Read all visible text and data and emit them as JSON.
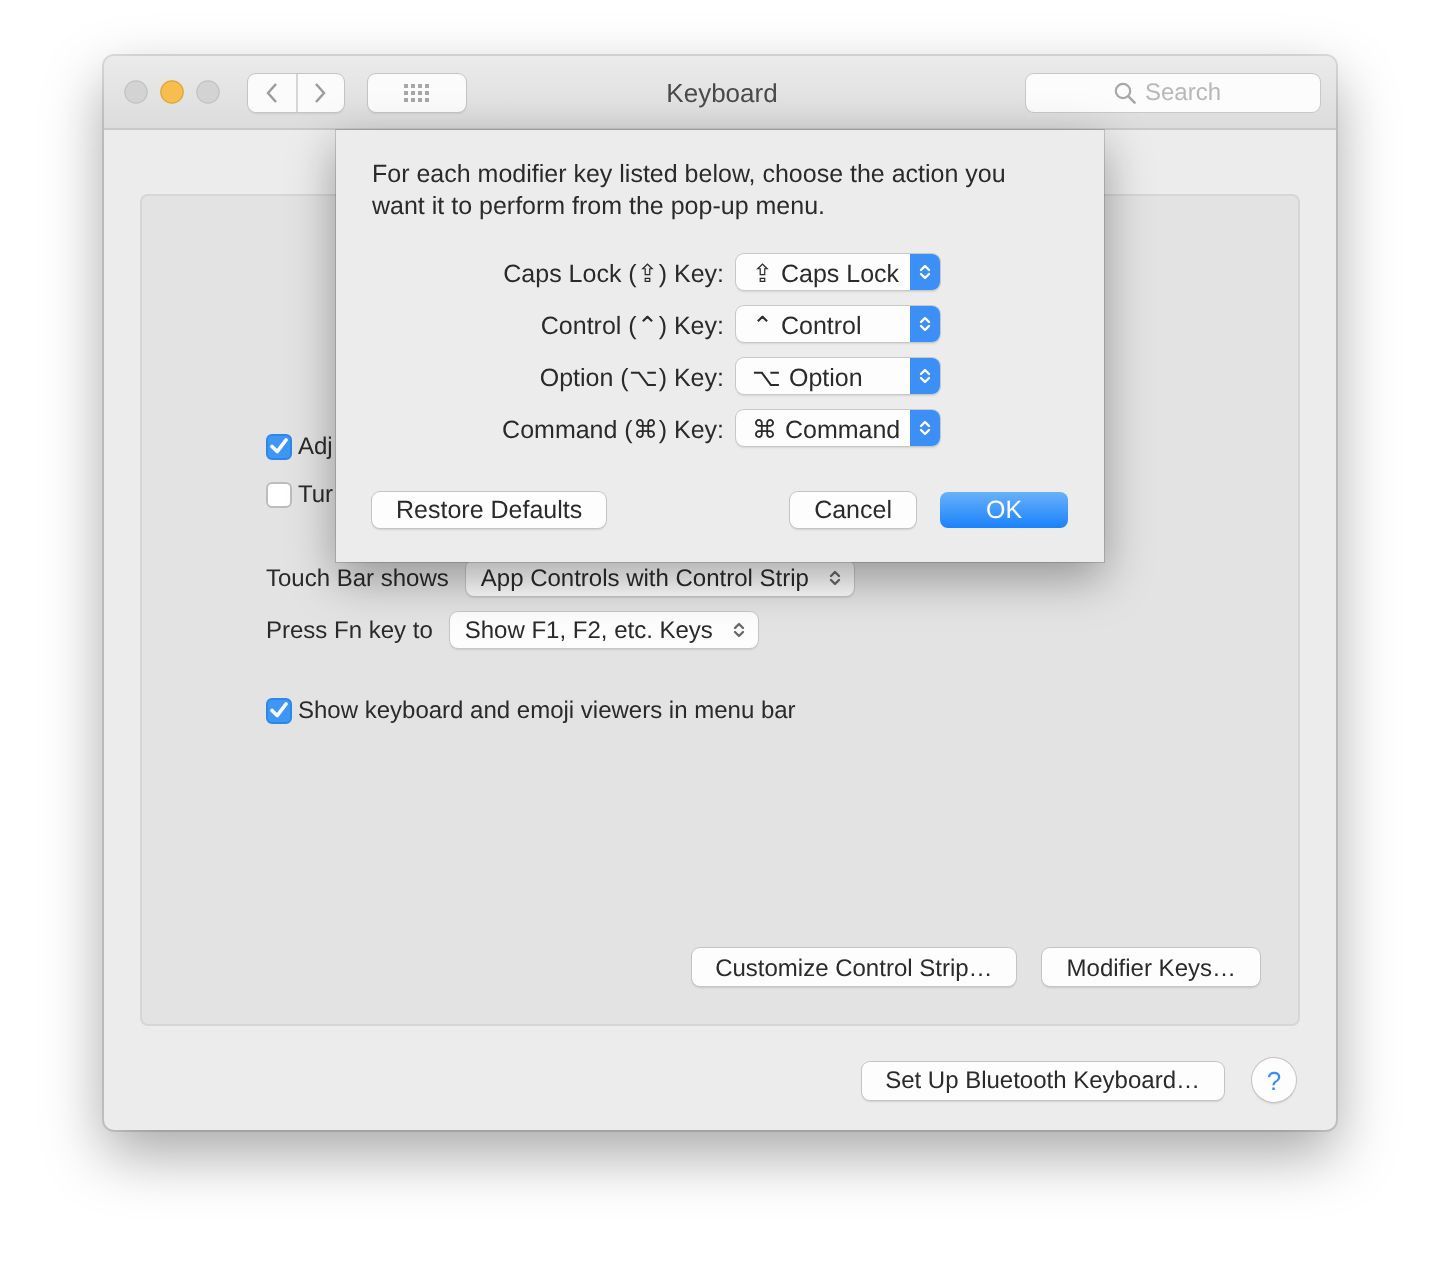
{
  "window": {
    "title": "Keyboard"
  },
  "toolbar": {
    "search": {
      "placeholder": "Search"
    }
  },
  "settings": {
    "checkboxes": [
      {
        "label": "Adj",
        "checked": true
      },
      {
        "label": "Tur",
        "checked": false
      }
    ],
    "popups": [
      {
        "label": "Touch Bar shows",
        "value": "App Controls with Control Strip"
      },
      {
        "label": "Press Fn key to",
        "value": "Show F1, F2, etc. Keys"
      }
    ],
    "options": [
      {
        "label": "Show keyboard and emoji viewers in menu bar",
        "checked": true
      }
    ],
    "buttons": [
      "Customize Control Strip…",
      "Modifier Keys…"
    ]
  },
  "footer": {
    "button": "Set Up Bluetooth Keyboard…",
    "help": "?"
  },
  "sheet": {
    "message": "For each modifier key listed below, choose the action you want it to perform from the pop-up menu.",
    "rows": [
      {
        "label": "Caps Lock (⇪) Key:",
        "value": "⇪ Caps Lock"
      },
      {
        "label": "Control (⌃) Key:",
        "value": "⌃ Control"
      },
      {
        "label": "Option (⌥) Key:",
        "value": "⌥ Option"
      },
      {
        "label": "Command (⌘) Key:",
        "value": "⌘ Command"
      }
    ],
    "buttons": [
      {
        "label": "Restore Defaults",
        "kind": "plain"
      },
      {
        "label": "Cancel",
        "kind": "plain"
      },
      {
        "label": "OK",
        "kind": "default"
      }
    ]
  }
}
